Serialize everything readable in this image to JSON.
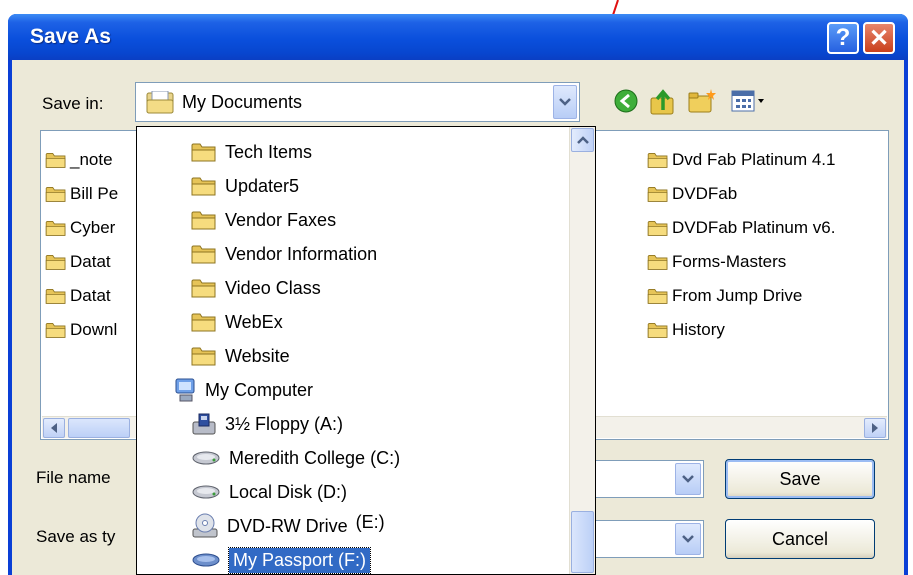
{
  "window": {
    "title": "Save As",
    "help_label": "?",
    "close_label": "✕"
  },
  "save_in": {
    "label": "Save in:",
    "value": "My Documents"
  },
  "file_list": {
    "left_column": [
      "_note",
      "Bill Pe",
      "Cyber",
      "Datat",
      "Datat",
      "Downl"
    ],
    "right_column": [
      "Dvd Fab Platinum 4.1",
      "DVDFab",
      "DVDFab Platinum v6.",
      "Forms-Masters",
      "From Jump Drive",
      "History"
    ]
  },
  "bottom": {
    "file_name_label": "File name",
    "save_as_type_label": "Save as ty",
    "save_label": "Save",
    "cancel_label": "Cancel"
  },
  "dropdown": {
    "folders": [
      "Tech Items",
      "Updater5",
      "Vendor Faxes",
      "Vendor Information",
      "Video Class",
      "WebEx",
      "Website"
    ],
    "computer": "My Computer",
    "drives": [
      {
        "label": "3½ Floppy (A:)",
        "icon": "floppy-drive-icon"
      },
      {
        "label": "Meredith College (C:)",
        "icon": "hard-disk-icon"
      },
      {
        "label": "Local Disk (D:)",
        "icon": "hard-disk-icon"
      },
      {
        "label": "DVD-RW Drive",
        "icon": "dvd-drive-icon",
        "letter": "(E:)"
      },
      {
        "label": "My Passport (F:)",
        "icon": "external-drive-icon",
        "selected": true
      }
    ]
  },
  "colors": {
    "titlebar": "#0a4fdc",
    "dialog_bg": "#ece9d8",
    "selection": "#316ac5",
    "annotation_arrow": "#e01010"
  }
}
